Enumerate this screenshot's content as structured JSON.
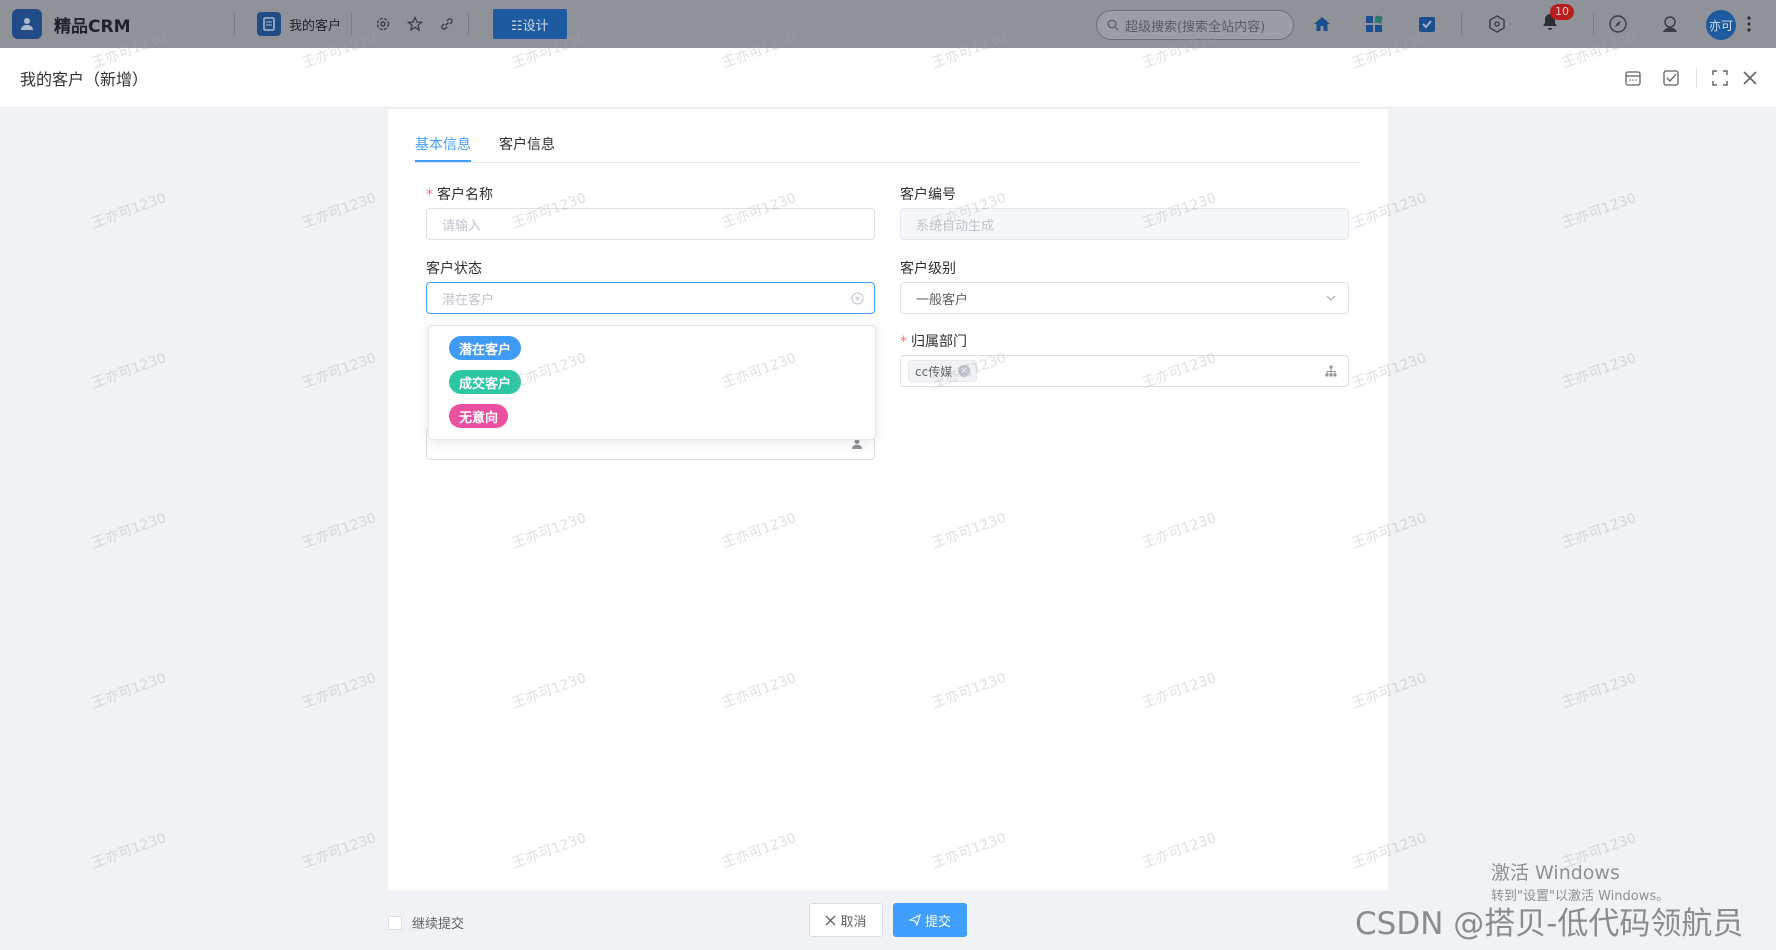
{
  "topbar": {
    "app_name": "精品CRM",
    "page_tab": "我的客户",
    "design_button": "☷设计",
    "search_placeholder": "超级搜索(搜索全站内容)",
    "notification_count": "10",
    "avatar_text": "亦可"
  },
  "modal": {
    "title": "我的客户（新增）"
  },
  "tabs": [
    {
      "label": "基本信息",
      "active": true
    },
    {
      "label": "客户信息",
      "active": false
    }
  ],
  "form": {
    "customer_name": {
      "label": "客户名称",
      "required": true,
      "placeholder": "请输入"
    },
    "customer_code": {
      "label": "客户编号",
      "placeholder": "系统自动生成"
    },
    "customer_status": {
      "label": "客户状态",
      "placeholder": "潜在客户"
    },
    "customer_level": {
      "label": "客户级别",
      "value": "一般客户"
    },
    "department": {
      "label": "归属部门",
      "required": true,
      "tag": "cc传媒"
    }
  },
  "status_options": [
    {
      "label": "潜在客户",
      "color": "#3f9bf5"
    },
    {
      "label": "成交客户",
      "color": "#2ec7a4"
    },
    {
      "label": "无意向",
      "color": "#e9509f"
    }
  ],
  "footer": {
    "continue_label": "继续提交",
    "cancel_label": "取消",
    "submit_label": "提交"
  },
  "system": {
    "activate_title": "激活 Windows",
    "activate_sub": "转到\"设置\"以激活 Windows。",
    "csdn": "CSDN @搭贝-低代码领航员"
  },
  "watermark_text": "王亦可1230",
  "colors": {
    "primary": "#409eff",
    "topbar_dim": "#8f9298"
  }
}
